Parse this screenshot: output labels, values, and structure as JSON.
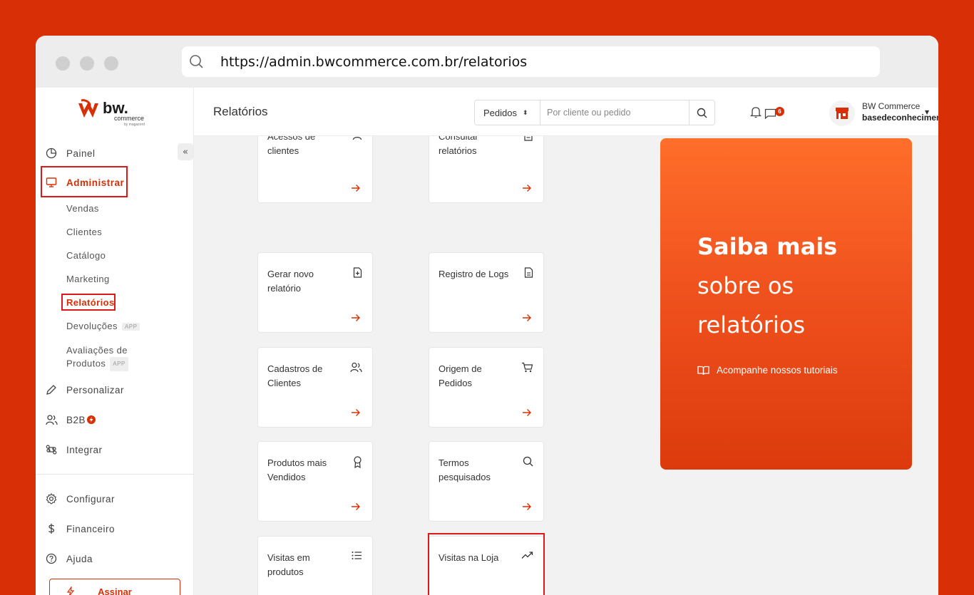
{
  "browser": {
    "url": "https://admin.bwcommerce.com.br/relatorios"
  },
  "logo": {
    "brand": "bw.",
    "sub": "commerce",
    "by": "by magazord"
  },
  "sidebar": {
    "items": {
      "painel": "Painel",
      "administrar": "Administrar",
      "personalizar": "Personalizar",
      "b2b": "B2B",
      "integrar": "Integrar",
      "configurar": "Configurar",
      "financeiro": "Financeiro",
      "ajuda": "Ajuda"
    },
    "subitems": {
      "vendas": "Vendas",
      "clientes": "Clientes",
      "catalogo": "Catálogo",
      "marketing": "Marketing",
      "relatorios": "Relatórios",
      "devolucoes": "Devoluções",
      "avaliacoes_1": "Avaliações de",
      "avaliacoes_2": "Produtos"
    },
    "app_badge": "APP",
    "assinar_label": "Assinar",
    "collapse_symbol": "«"
  },
  "header": {
    "title": "Relatórios",
    "search_select_value": "Pedidos",
    "search_placeholder": "Por cliente ou pedido",
    "messages_count": "6",
    "user_company": "BW Commerce",
    "user_account": "basedeconhecimento"
  },
  "cards": [
    {
      "title": "Acessos de clientes",
      "icon": "user-icon"
    },
    {
      "title": "Consultar relatórios",
      "icon": "document-list-icon"
    },
    {
      "title": "Gerar novo relatório",
      "icon": "file-plus-icon"
    },
    {
      "title": "Registro de Logs",
      "icon": "file-text-icon"
    },
    {
      "title": "Cadastros de Clientes",
      "icon": "users-icon"
    },
    {
      "title": "Origem de Pedidos",
      "icon": "cart-icon"
    },
    {
      "title": "Produtos mais Vendidos",
      "icon": "award-icon"
    },
    {
      "title": "Termos pesquisados",
      "icon": "search-icon"
    },
    {
      "title": "Visitas em produtos",
      "icon": "list-icon"
    },
    {
      "title": "Visitas na Loja",
      "icon": "trending-up-icon"
    }
  ],
  "promo": {
    "line1": "Saiba mais",
    "line2": "sobre os",
    "line3": "relatórios",
    "link": "Acompanhe nossos tutoriais"
  },
  "colors": {
    "accent": "#d92f07",
    "highlight": "#e01818",
    "background": "#d92f07"
  }
}
